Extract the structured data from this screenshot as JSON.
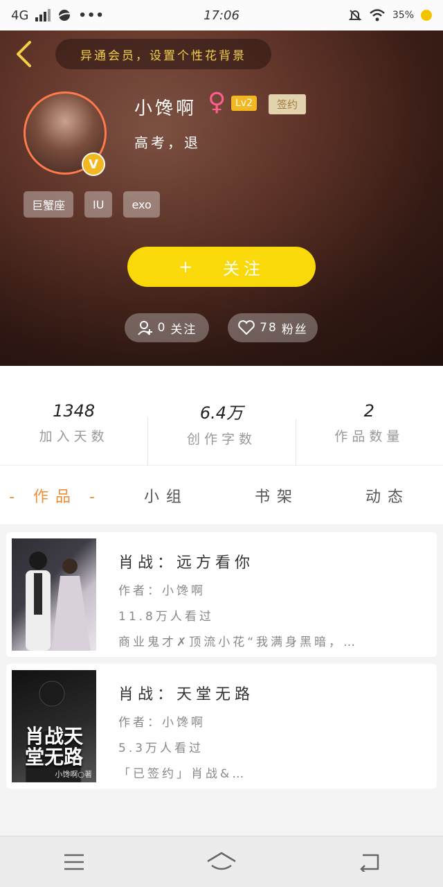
{
  "status_bar": {
    "network": "4G",
    "time": "17:06",
    "battery": "35%"
  },
  "header": {
    "hint": "异通会员，设置个性花背景",
    "username": "小馋啊",
    "gender_symbol": "♀",
    "level": "Lv2",
    "signed_badge": "签约",
    "bio": "高考，退",
    "avatar_badge": "V",
    "tags": [
      "巨蟹座",
      "IU",
      "exo"
    ],
    "follow_button": {
      "plus": "+",
      "label": "关注"
    },
    "following": {
      "count": "0",
      "label": "关注"
    },
    "fans": {
      "count": "78",
      "label": "粉丝"
    }
  },
  "stats": [
    {
      "value": "1348",
      "label": "加入天数"
    },
    {
      "value": "6.4万",
      "label": "创作字数"
    },
    {
      "value": "2",
      "label": "作品数量"
    }
  ],
  "tabs": [
    {
      "label": "- 作品 -",
      "active": true
    },
    {
      "label": "小组",
      "active": false
    },
    {
      "label": "书架",
      "active": false
    },
    {
      "label": "动态",
      "active": false
    }
  ],
  "works": [
    {
      "title": "肖战：远方看你",
      "author": "作者：小馋啊",
      "views": "11.8万人看过",
      "summary": "商业鬼才✗顶流小花“我满身黑暗，…"
    },
    {
      "title": "肖战：天堂无路",
      "author": "作者：小馋啊",
      "views": "5.3万人看过",
      "summary": "「已签约」肖战&…",
      "cover_title": "肖战天堂无路",
      "cover_author": "小馋啊○著"
    }
  ],
  "colors": {
    "accent_yellow": "#f9d90a",
    "tab_active": "#ee8d3a",
    "gender_pink": "#ff5d8f"
  }
}
